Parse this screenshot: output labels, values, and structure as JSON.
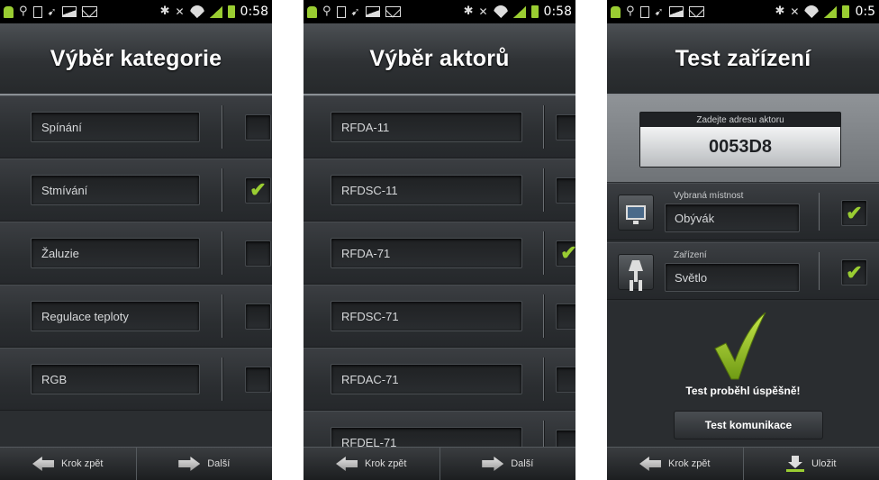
{
  "status_bar": {
    "time": "0:58",
    "time_clipped": "0:5"
  },
  "screen1": {
    "title": "Výběr kategorie",
    "items": [
      {
        "label": "Spínání",
        "checked": false
      },
      {
        "label": "Stmívání",
        "checked": true
      },
      {
        "label": "Žaluzie",
        "checked": false
      },
      {
        "label": "Regulace teploty",
        "checked": false
      },
      {
        "label": "RGB",
        "checked": false
      }
    ],
    "back_label": "Krok zpět",
    "next_label": "Další"
  },
  "screen2": {
    "title": "Výběr aktorů",
    "items": [
      {
        "label": "RFDA-11",
        "checked": false
      },
      {
        "label": "RFDSC-11",
        "checked": false
      },
      {
        "label": "RFDA-71",
        "checked": true
      },
      {
        "label": "RFDSC-71",
        "checked": false
      },
      {
        "label": "RFDAC-71",
        "checked": false
      },
      {
        "label": "RFDEL-71",
        "checked": false
      }
    ],
    "back_label": "Krok zpět",
    "next_label": "Další"
  },
  "screen3": {
    "title": "Test zařízení",
    "address_label": "Zadejte adresu aktoru",
    "address_value": "0053D8",
    "room_label": "Vybraná místnost",
    "room_value": "Obývák",
    "device_label": "Zařízení",
    "device_value": "Světlo",
    "result_text": "Test proběhl úspěšně!",
    "test_button": "Test komunikace",
    "back_label": "Krok zpět",
    "save_label": "Uložit"
  },
  "check_glyph": "✔",
  "colors": {
    "accent_green": "#9acd32",
    "background": "#2b2e31"
  }
}
